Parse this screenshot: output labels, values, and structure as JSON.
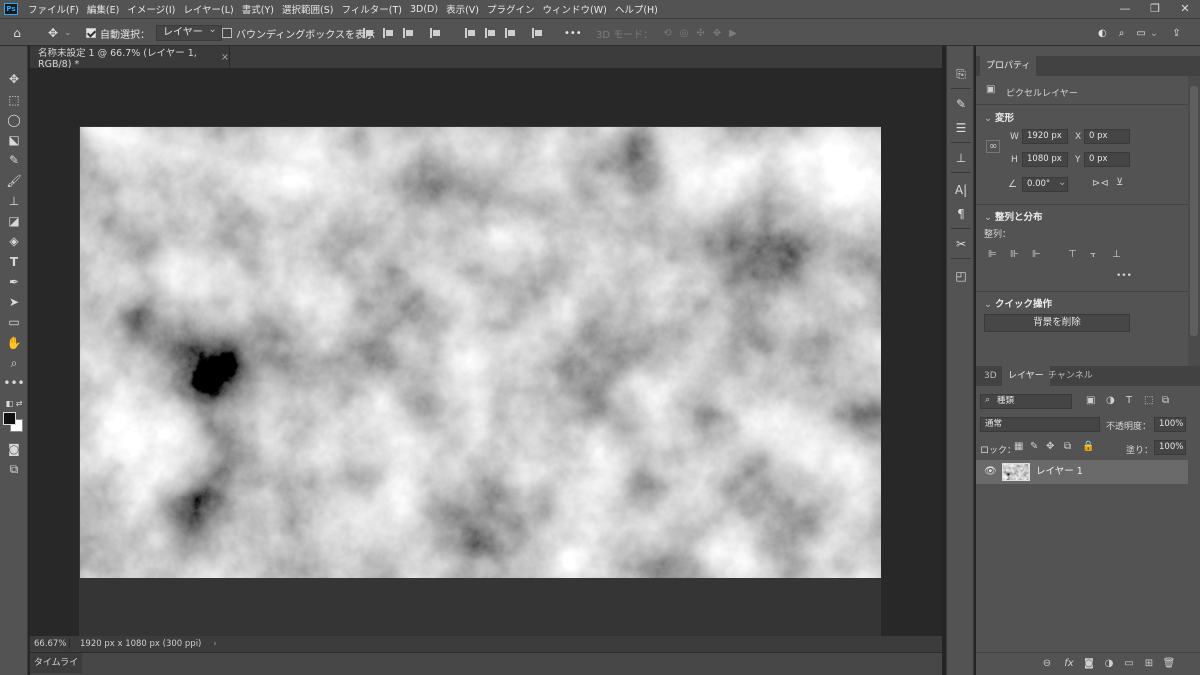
{
  "menubar": {
    "logo": "Ps",
    "items": [
      "ファイル(F)",
      "編集(E)",
      "イメージ(I)",
      "レイヤー(L)",
      "書式(Y)",
      "選択範囲(S)",
      "フィルター(T)",
      "3D(D)",
      "表示(V)",
      "プラグイン",
      "ウィンドウ(W)",
      "ヘルプ(H)"
    ],
    "window_controls": [
      "—",
      "❐",
      "✕"
    ]
  },
  "options": {
    "auto_select_label": "自動選択：",
    "auto_select_checked": true,
    "target_dropdown": "レイヤー",
    "bounding_box_label": "バウンディングボックスを表示",
    "bounding_box_checked": false,
    "more": "•••",
    "mode_3d_label": "3D モード："
  },
  "document": {
    "tab_title": "名称未設定 1 @ 66.7% (レイヤー 1, RGB/8) *",
    "close": "×"
  },
  "status": {
    "zoom": "66.67%",
    "info": "1920 px x 1080 px (300 ppi)",
    "arrow": "›"
  },
  "timeline": {
    "tab_label": "タイムライン"
  },
  "properties": {
    "tab_label": "プロパティ",
    "layer_type": "ピクセルレイヤー",
    "transform_title": "変形",
    "w_label": "W",
    "w_value": "1920 px",
    "h_label": "H",
    "h_value": "1080 px",
    "x_label": "X",
    "x_value": "0 px",
    "y_label": "Y",
    "y_value": "0 px",
    "angle_value": "0.00°",
    "align_title": "整列と分布",
    "align_label": "整列：",
    "more": "•••",
    "quick_title": "クイック操作",
    "remove_bg_label": "背景を削除"
  },
  "layers": {
    "tabs": [
      "3D",
      "レイヤー",
      "チャンネル"
    ],
    "active_tab": "レイヤー",
    "filter_dropdown": "種類",
    "blend_mode": "通常",
    "opacity_label": "不透明度：",
    "opacity_value": "100%",
    "lock_label": "ロック：",
    "fill_label": "塗り：",
    "fill_value": "100%",
    "items": [
      {
        "name": "レイヤー 1",
        "visible": true,
        "selected": true
      }
    ]
  },
  "colors": {
    "ui_bg": "#535353",
    "canvas_pasteboard": "#282828",
    "accent": "#31a8ff"
  }
}
